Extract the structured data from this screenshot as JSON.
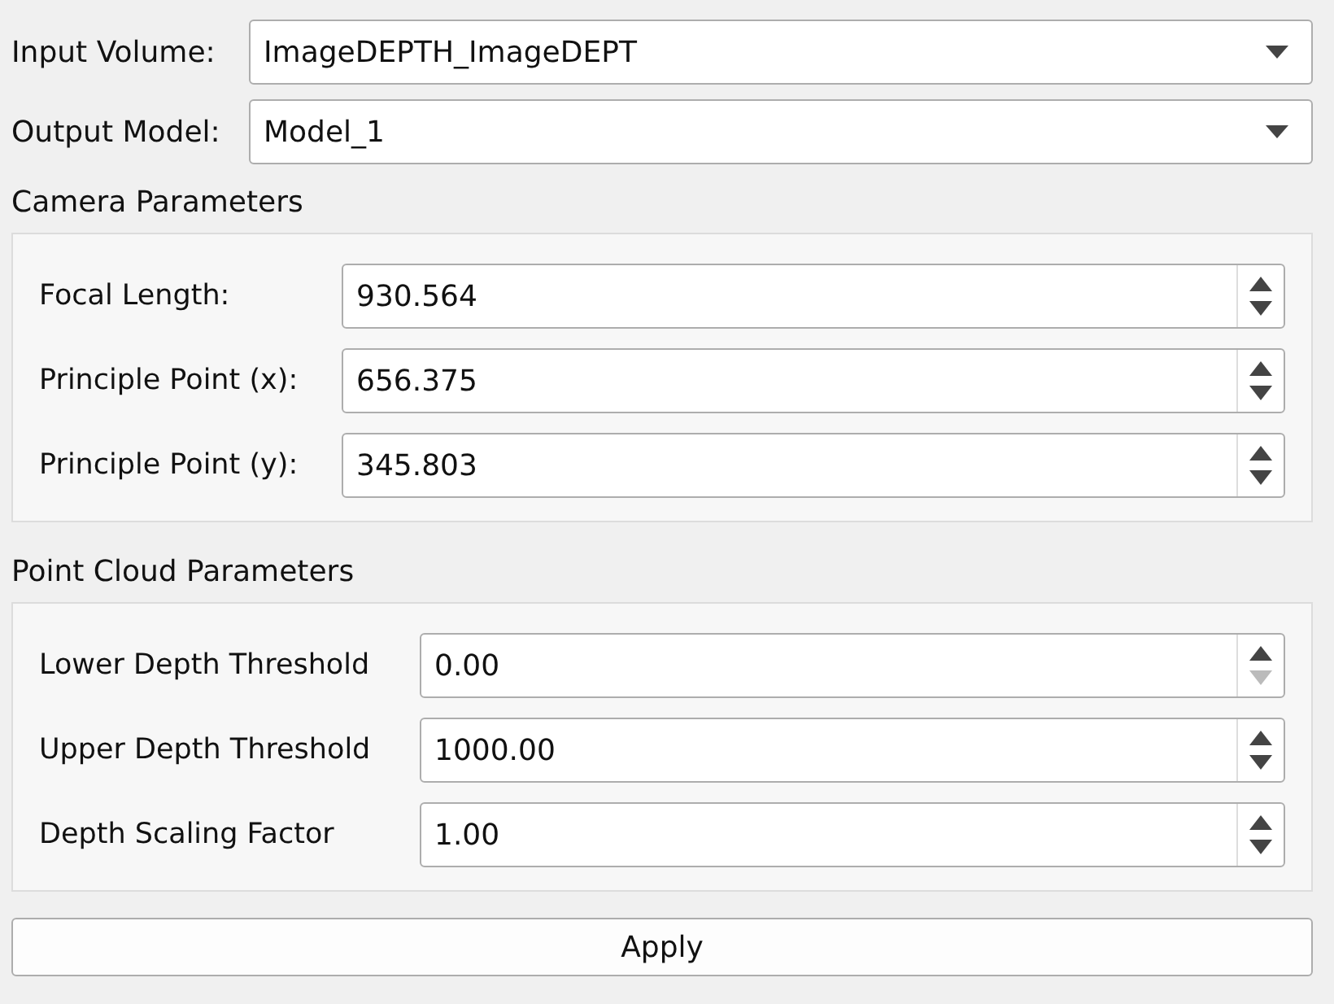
{
  "selectors": [
    {
      "label": "Input Volume:",
      "value": "ImageDEPTH_ImageDEPT"
    },
    {
      "label": "Output Model:",
      "value": "Model_1"
    }
  ],
  "groups": [
    {
      "title": "Camera Parameters",
      "fields": [
        {
          "label": "Focal Length:",
          "value": "930.564",
          "up_disabled": false,
          "down_disabled": false
        },
        {
          "label": "Principle Point (x):",
          "value": "656.375",
          "up_disabled": false,
          "down_disabled": false
        },
        {
          "label": "Principle Point (y):",
          "value": "345.803",
          "up_disabled": false,
          "down_disabled": false
        }
      ]
    },
    {
      "title": "Point Cloud Parameters",
      "fields": [
        {
          "label": "Lower Depth Threshold",
          "value": "0.00",
          "up_disabled": false,
          "down_disabled": true
        },
        {
          "label": "Upper Depth Threshold",
          "value": "1000.00",
          "up_disabled": false,
          "down_disabled": false
        },
        {
          "label": "Depth Scaling Factor",
          "value": "1.00",
          "up_disabled": false,
          "down_disabled": false
        }
      ]
    }
  ],
  "apply_button": "Apply"
}
